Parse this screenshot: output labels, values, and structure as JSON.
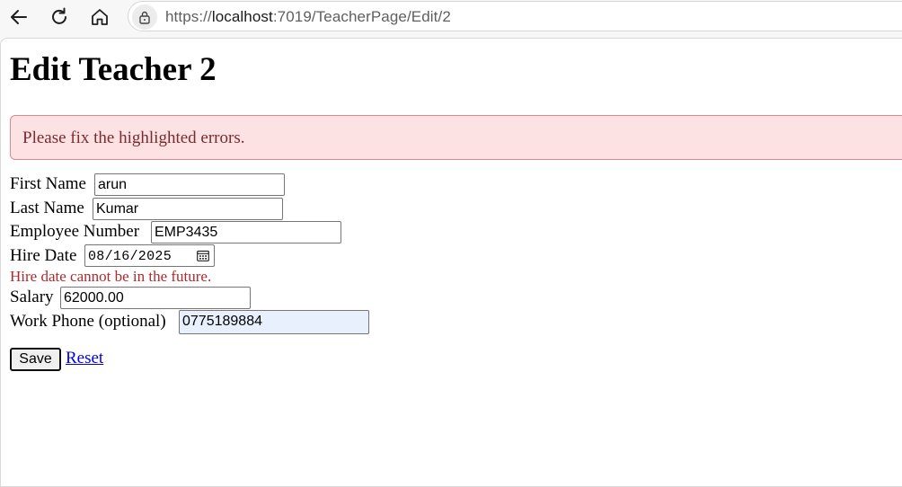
{
  "browser": {
    "url_prefix": "https://",
    "url_host": "localhost",
    "url_path": ":7019/TeacherPage/Edit/2",
    "icons": [
      "back-icon",
      "reload-icon",
      "home-icon",
      "lock-icon"
    ]
  },
  "page": {
    "title": "Edit Teacher 2",
    "alert": "Please fix the highlighted errors.",
    "alert_colors": {
      "background": "#fde2e4",
      "border": "#d98a8f",
      "text": "#7a2a2f"
    },
    "error_color": "#b0282e"
  },
  "form": {
    "first_name": {
      "label": "First Name",
      "value": "arun"
    },
    "last_name": {
      "label": "Last Name",
      "value": "Kumar"
    },
    "employee_number": {
      "label": "Employee Number",
      "value": "EMP3435"
    },
    "hire_date": {
      "label": "Hire Date",
      "value": "08/16/2025",
      "error": "Hire date cannot be in the future."
    },
    "salary": {
      "label": "Salary",
      "value": "62000.00"
    },
    "work_phone": {
      "label": "Work Phone (optional)",
      "value": "0775189884"
    },
    "save_label": "Save",
    "reset_label": "Reset"
  }
}
